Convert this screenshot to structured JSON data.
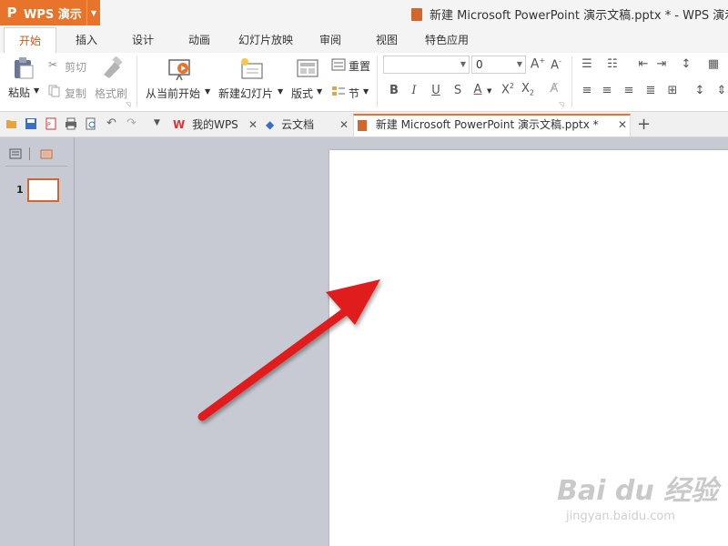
{
  "app": {
    "logo": "P",
    "name": "WPS 演示",
    "brand_color": "#e8732b"
  },
  "window_title": "新建 Microsoft PowerPoint 演示文稿.pptx * - WPS 演示",
  "menu_tabs": [
    "开始",
    "插入",
    "设计",
    "动画",
    "幻灯片放映",
    "审阅",
    "视图",
    "特色应用"
  ],
  "ribbon": {
    "paste": "粘贴",
    "cut": "剪切",
    "copy": "复制",
    "format_painter": "格式刷",
    "from_current": "从当前开始",
    "new_slide": "新建幻灯片",
    "layout": "版式",
    "reset": "重置",
    "section": "节",
    "font_name_value": "",
    "font_size_value": "0"
  },
  "tabs": [
    {
      "label": "我的WPS",
      "icon": "wps-icon"
    },
    {
      "label": "云文档",
      "icon": "cloud-doc-icon"
    },
    {
      "label": "新建 Microsoft PowerPoint 演示文稿.pptx *",
      "icon": "ppt-file-icon"
    }
  ],
  "slides_pane": {
    "slide_number": "1"
  },
  "watermark": {
    "main": "Bai du 经验",
    "sub": "jingyan.baidu.com"
  }
}
